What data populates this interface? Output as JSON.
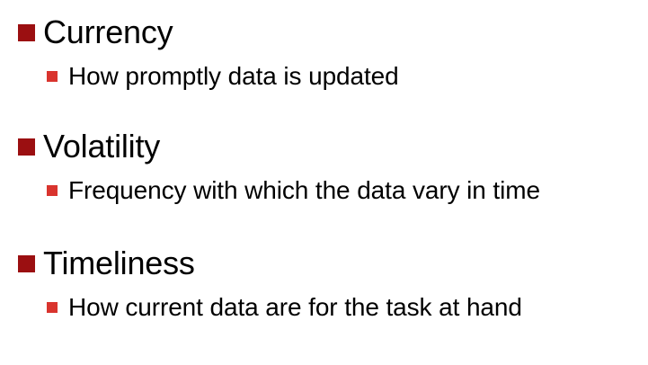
{
  "colors": {
    "primary_bullet": "#9b0f11",
    "secondary_bullet": "#d9342e",
    "text": "#000000",
    "background": "#ffffff"
  },
  "bullets": [
    {
      "title": "Currency",
      "detail": "How promptly data is updated"
    },
    {
      "title": "Volatility",
      "detail": "Frequency with which the data vary in time"
    },
    {
      "title": "Timeliness",
      "detail": "How current data are for the task at hand"
    }
  ]
}
